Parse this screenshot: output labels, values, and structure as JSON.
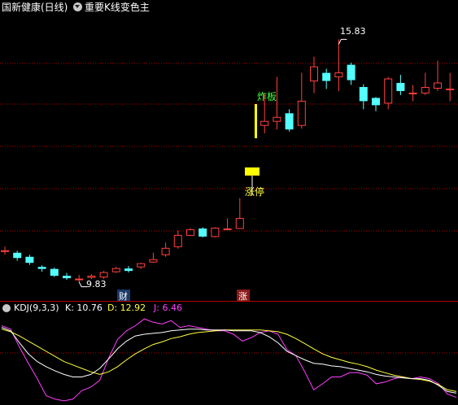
{
  "header": {
    "stock_title": "国新健康(日线)",
    "formula_name": "重要K线变色主"
  },
  "price_panel": {
    "high_label": "15.83",
    "low_label": "9.83",
    "annotations": {
      "zhaban": "炸板",
      "zhangting": "涨停",
      "cai": "财",
      "zhang": "涨"
    }
  },
  "indicator_panel": {
    "name": "KDJ(9,3,3)",
    "k_label": "K: 10.76",
    "d_label": "D: 12.92",
    "j_label": "J: 6.46"
  },
  "colors": {
    "up": "#ff4040",
    "down": "#54ffff",
    "grid": "#b40000",
    "k_line": "#ffffff",
    "d_line": "#ffff40",
    "j_line": "#ff40ff",
    "limit_up_mark": "#ffff00"
  },
  "chart_data": {
    "type": "candlestick",
    "series": [
      {
        "name": "price",
        "values": [
          {
            "o": 10.6,
            "c": 10.6,
            "h": 10.7,
            "l": 10.5
          },
          {
            "o": 10.55,
            "c": 10.42,
            "h": 10.6,
            "l": 10.35
          },
          {
            "o": 10.45,
            "c": 10.3,
            "h": 10.5,
            "l": 10.25
          },
          {
            "o": 10.2,
            "c": 10.15,
            "h": 10.24,
            "l": 10.08
          },
          {
            "o": 10.15,
            "c": 9.98,
            "h": 10.18,
            "l": 9.95
          },
          {
            "o": 9.98,
            "c": 9.92,
            "h": 10.05,
            "l": 9.88
          },
          {
            "o": 9.9,
            "c": 9.9,
            "h": 10.0,
            "l": 9.83
          },
          {
            "o": 9.94,
            "c": 9.97,
            "h": 10.02,
            "l": 9.9
          },
          {
            "o": 9.95,
            "c": 10.06,
            "h": 10.1,
            "l": 9.9
          },
          {
            "o": 10.08,
            "c": 10.16,
            "h": 10.2,
            "l": 10.05
          },
          {
            "o": 10.16,
            "c": 10.1,
            "h": 10.22,
            "l": 10.06
          },
          {
            "o": 10.2,
            "c": 10.28,
            "h": 10.3,
            "l": 10.15
          },
          {
            "o": 10.32,
            "c": 10.38,
            "h": 10.55,
            "l": 10.3
          },
          {
            "o": 10.5,
            "c": 10.66,
            "h": 10.8,
            "l": 10.45
          },
          {
            "o": 10.7,
            "c": 10.98,
            "h": 11.1,
            "l": 10.65
          },
          {
            "o": 10.98,
            "c": 11.12,
            "h": 11.16,
            "l": 10.96
          },
          {
            "o": 11.15,
            "c": 10.95,
            "h": 11.18,
            "l": 10.93
          },
          {
            "o": 10.95,
            "c": 11.16,
            "h": 11.18,
            "l": 10.93
          },
          {
            "o": 11.14,
            "c": 11.14,
            "h": 11.4,
            "l": 11.12
          },
          {
            "o": 11.15,
            "c": 11.4,
            "h": 11.9,
            "l": 11.14
          },
          {
            "o": 12.54,
            "c": 12.54,
            "h": 12.54,
            "l": 12.54
          },
          {
            "o": 13.7,
            "c": 13.8,
            "h": 14.5,
            "l": 13.5
          },
          {
            "o": 13.8,
            "c": 13.9,
            "h": 14.9,
            "l": 13.6
          },
          {
            "o": 14.0,
            "c": 13.6,
            "h": 14.1,
            "l": 13.55
          },
          {
            "o": 13.7,
            "c": 14.3,
            "h": 15.0,
            "l": 13.62
          },
          {
            "o": 14.8,
            "c": 15.15,
            "h": 15.4,
            "l": 14.5
          },
          {
            "o": 15.0,
            "c": 14.8,
            "h": 15.1,
            "l": 14.6
          },
          {
            "o": 14.9,
            "c": 15.0,
            "h": 15.83,
            "l": 14.55
          },
          {
            "o": 15.2,
            "c": 14.82,
            "h": 15.25,
            "l": 14.7
          },
          {
            "o": 14.65,
            "c": 14.3,
            "h": 14.72,
            "l": 14.1
          },
          {
            "o": 14.38,
            "c": 14.2,
            "h": 14.4,
            "l": 14.05
          },
          {
            "o": 14.25,
            "c": 14.85,
            "h": 14.9,
            "l": 14.1
          },
          {
            "o": 14.75,
            "c": 14.55,
            "h": 14.95,
            "l": 14.45
          },
          {
            "o": 14.5,
            "c": 14.5,
            "h": 14.7,
            "l": 14.3
          },
          {
            "o": 14.5,
            "c": 14.64,
            "h": 15.0,
            "l": 14.45
          },
          {
            "o": 14.62,
            "c": 14.75,
            "h": 15.3,
            "l": 14.55
          },
          {
            "o": 14.6,
            "c": 14.6,
            "h": 15.0,
            "l": 14.3
          },
          {
            "o": 14.7,
            "c": 14.42,
            "h": 14.9,
            "l": 14.3
          }
        ]
      }
    ],
    "price_range": [
      9.6,
      16.4
    ],
    "kdj": {
      "K": [
        88,
        84,
        70,
        57,
        48,
        42,
        37,
        33,
        30,
        30,
        33,
        40,
        51,
        63,
        72,
        78,
        80,
        81,
        82,
        84,
        85,
        86,
        86,
        85,
        85,
        85,
        84,
        84,
        84,
        82,
        77,
        70,
        60,
        55,
        50,
        46,
        45,
        43,
        42,
        40,
        38,
        36,
        33,
        31,
        30,
        29,
        28,
        28,
        26,
        20,
        13,
        11
      ],
      "D": [
        86,
        83,
        78,
        72,
        66,
        60,
        54,
        48,
        44,
        40,
        36,
        33,
        36,
        42,
        50,
        57,
        63,
        68,
        71,
        75,
        77,
        80,
        82,
        83,
        84,
        85,
        85,
        85,
        85,
        85,
        84,
        83,
        80,
        75,
        69,
        63,
        57,
        53,
        50,
        47,
        45,
        42,
        38,
        35,
        32,
        30,
        28,
        27,
        25,
        21,
        15,
        13
      ],
      "J": [
        90,
        86,
        65,
        46,
        28,
        8,
        4,
        2,
        4,
        14,
        18,
        26,
        52,
        74,
        84,
        90,
        98,
        94,
        92,
        96,
        88,
        90,
        88,
        86,
        84,
        84,
        80,
        72,
        76,
        82,
        84,
        80,
        62,
        55,
        36,
        15,
        22,
        30,
        30,
        35,
        35,
        32,
        22,
        24,
        28,
        30,
        28,
        30,
        28,
        22,
        10,
        6
      ],
      "range": [
        0,
        100
      ]
    }
  }
}
